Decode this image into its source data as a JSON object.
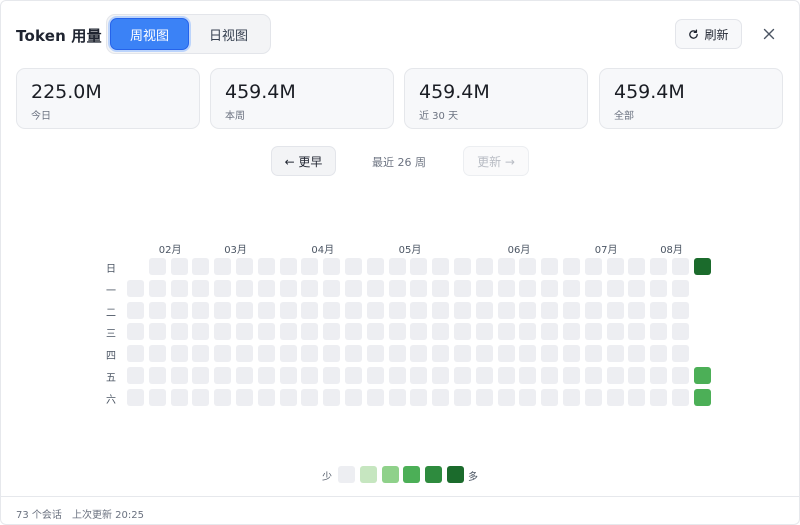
{
  "header": {
    "title": "Token 用量",
    "tabs": [
      {
        "label": "周视图",
        "active": true
      },
      {
        "label": "日视图",
        "active": false
      }
    ],
    "refresh_label": "刷新",
    "refresh_icon": "refresh-icon",
    "close_icon": "close-icon"
  },
  "stats": [
    {
      "value": "225.0M",
      "label": "今日"
    },
    {
      "value": "459.4M",
      "label": "本周"
    },
    {
      "value": "459.4M",
      "label": "近 30 天"
    },
    {
      "value": "459.4M",
      "label": "全部"
    }
  ],
  "pager": {
    "older_label": "← 更早",
    "range_label": "最近 26 周",
    "newer_label": "更新 →",
    "newer_disabled": true
  },
  "heatmap": {
    "weeks": 27,
    "months": [
      {
        "label": "02月",
        "week": 1
      },
      {
        "label": "03月",
        "week": 4
      },
      {
        "label": "04月",
        "week": 8
      },
      {
        "label": "05月",
        "week": 12
      },
      {
        "label": "06月",
        "week": 17
      },
      {
        "label": "07月",
        "week": 21
      },
      {
        "label": "08月",
        "week": 24
      }
    ],
    "day_labels": [
      "日",
      "一",
      "二",
      "三",
      "四",
      "五",
      "六"
    ],
    "first_week_missing_days": [
      0
    ],
    "last_week_present_days": [
      0,
      5,
      6
    ],
    "active_cells": [
      {
        "week": 26,
        "day": 0,
        "level": 5
      },
      {
        "week": 26,
        "day": 5,
        "level": 3
      },
      {
        "week": 26,
        "day": 6,
        "level": 3
      }
    ],
    "level_colors": [
      "#edeef2",
      "#c6e6c0",
      "#8fd18a",
      "#4caf57",
      "#2e8b3e",
      "#1b6b2c"
    ]
  },
  "legend": {
    "less": "少",
    "more": "多"
  },
  "footer": {
    "sessions": "73 个会话",
    "last_update": "上次更新 20:25"
  }
}
